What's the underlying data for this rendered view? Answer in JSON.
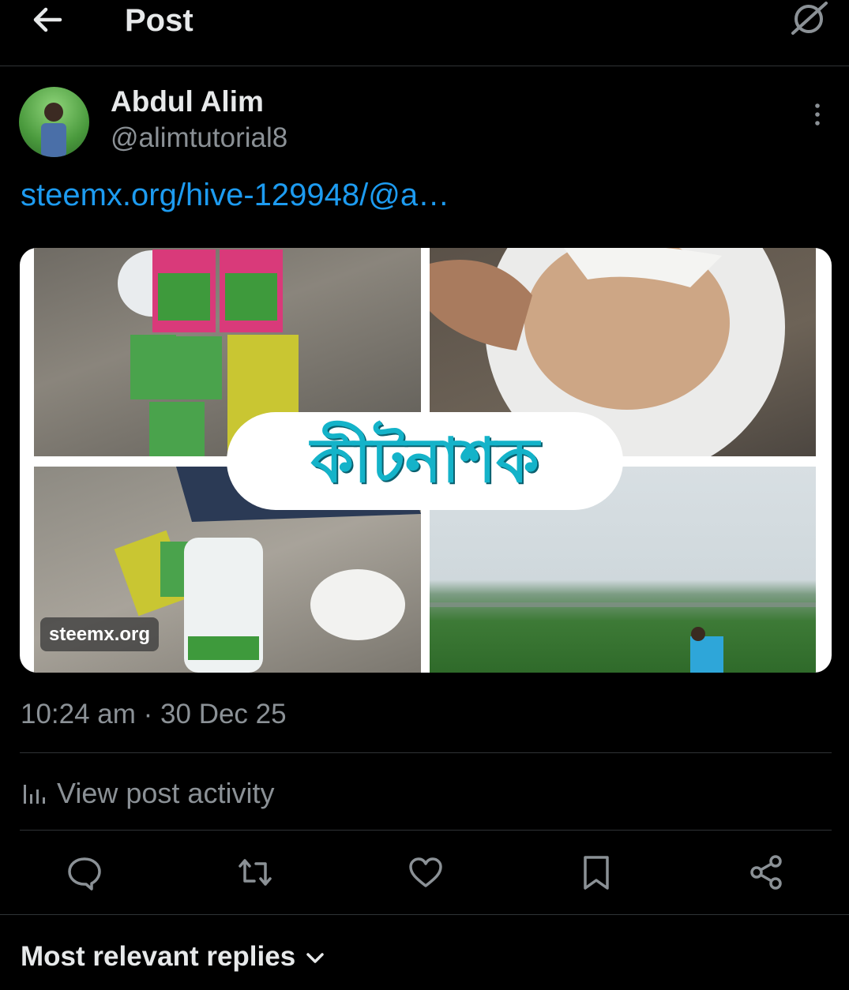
{
  "header": {
    "title": "Post",
    "back_icon": "arrow-left-icon",
    "grok_icon": "grok-icon"
  },
  "post": {
    "author_name": "Abdul Alim",
    "author_handle": "@alimtutorial8",
    "link_text": "steemx.org/hive-129948/@a…",
    "media": {
      "banner_text": "কীটনাশক",
      "source_label": "steemx.org"
    },
    "timestamp": "10:24 am · 30 Dec 25",
    "activity_label": "View post activity"
  },
  "actions": {
    "reply": "reply-icon",
    "repost": "repost-icon",
    "like": "heart-icon",
    "bookmark": "bookmark-icon",
    "share": "share-icon"
  },
  "replies": {
    "label": "Most relevant replies"
  },
  "colors": {
    "accent": "#1d9bf0",
    "muted": "#8b9196",
    "divider": "#2f3336"
  }
}
